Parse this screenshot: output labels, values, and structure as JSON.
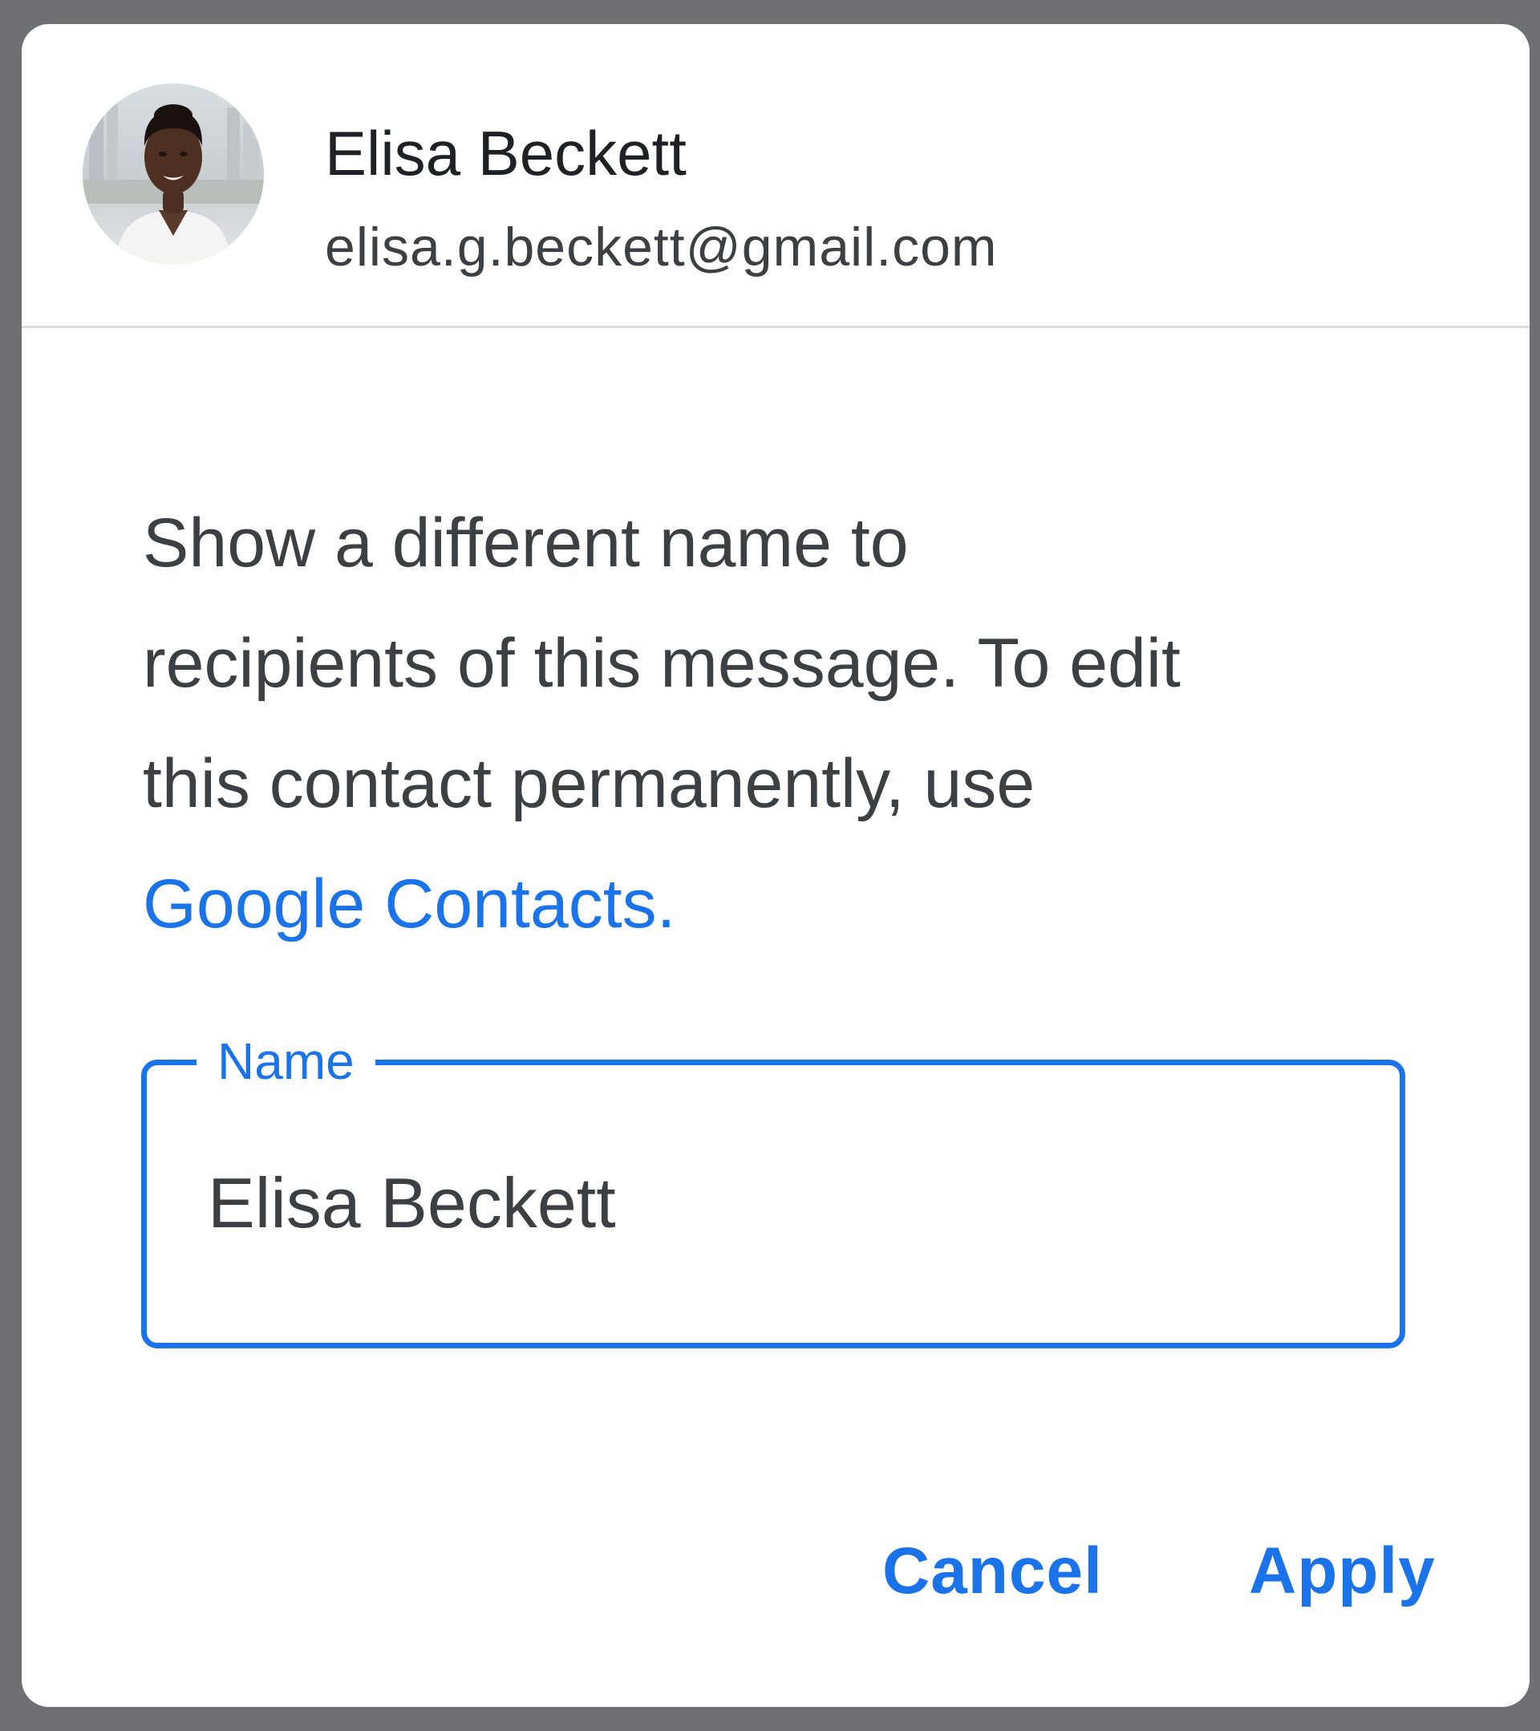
{
  "dialog": {
    "profile": {
      "name": "Elisa Beckett",
      "email": "elisa.g.beckett@gmail.com",
      "avatar": "profile-photo"
    },
    "message": {
      "line1": "Show a different name to",
      "line2": "recipients of this message. To edit",
      "line3": "this contact permanently, use",
      "link_text": "Google Contacts."
    },
    "name_field": {
      "label": "Name",
      "value": "Elisa Beckett"
    },
    "actions": {
      "cancel_label": "Cancel",
      "apply_label": "Apply"
    }
  },
  "colors": {
    "accent": "#1a73e8",
    "backdrop": "#6f7073",
    "surface": "#ffffff",
    "text_primary": "#202124",
    "text_secondary": "#3c4043",
    "divider": "#dadce0"
  }
}
